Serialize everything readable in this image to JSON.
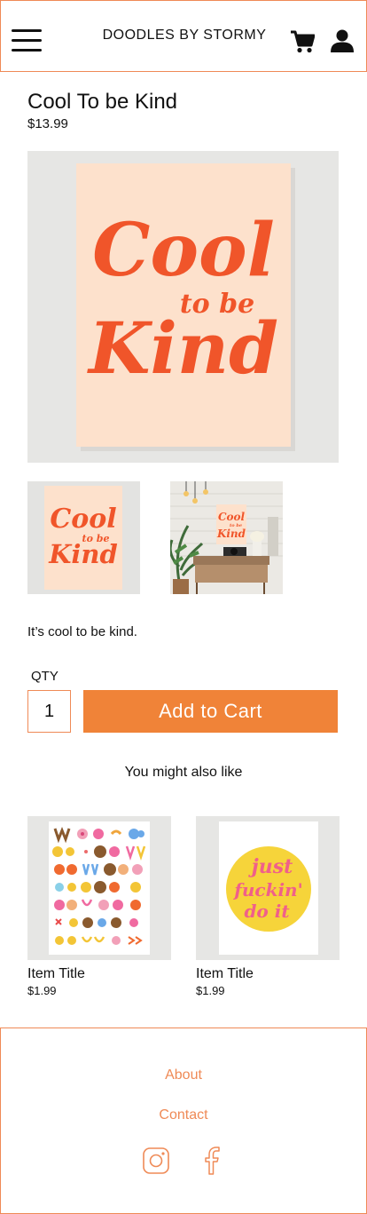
{
  "header": {
    "brand": "DOODLES BY STORMY",
    "icons": {
      "menu": "hamburger-menu-icon",
      "cart": "cart-icon",
      "account": "user-icon"
    }
  },
  "product": {
    "title": "Cool To be Kind",
    "price": "$13.99",
    "description": "It’s cool to be kind.",
    "artwork_text": [
      "Cool",
      "to be",
      "Kind"
    ],
    "thumbnail_artwork_text": [
      "Cool",
      "to be",
      "Kind"
    ],
    "room_artwork_text": [
      "Cool",
      "to be",
      "Kind"
    ]
  },
  "purchase": {
    "qty_label": "QTY",
    "qty_value": "1",
    "add_to_cart_label": "Add to Cart"
  },
  "recommendations": {
    "heading": "You might also like",
    "items": [
      {
        "title": "Item Title",
        "price": "$1.99"
      },
      {
        "title": "Item Title",
        "price": "$1.99",
        "artwork_text": [
          "just",
          "fuckin'",
          "do it"
        ]
      }
    ]
  },
  "footer": {
    "links": {
      "about": "About",
      "contact": "Contact"
    },
    "social_icons": [
      "instagram-icon",
      "facebook-icon"
    ]
  },
  "colors": {
    "accent": "#f08338",
    "border": "#ef8a56",
    "poster_bg": "#fde1cc",
    "poster_ink": "#f0552a",
    "yellow_circle": "#f6d43a",
    "pink_lettering": "#f0608a"
  }
}
